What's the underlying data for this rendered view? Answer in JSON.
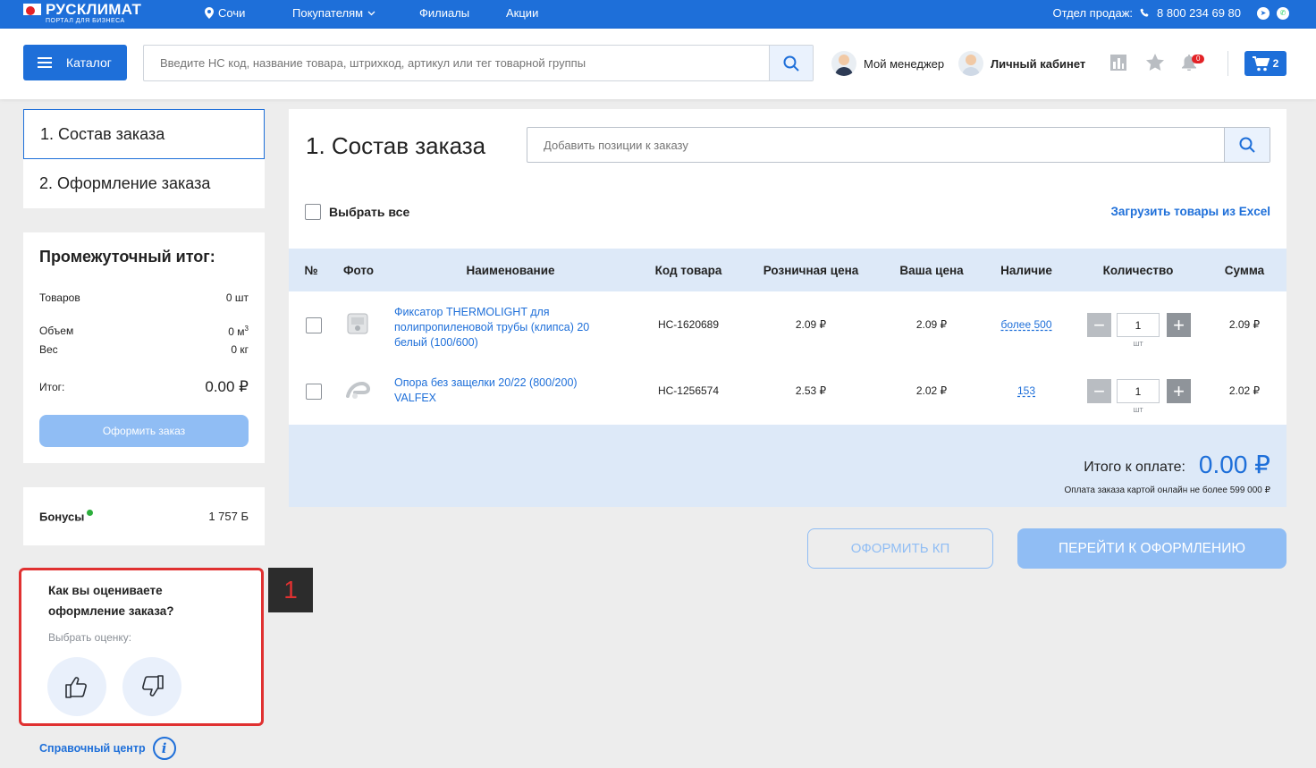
{
  "topbar": {
    "logo_main": "РУСКЛИМАТ",
    "logo_sub": "ПОРТАЛ ДЛЯ БИЗНЕСА",
    "city": "Сочи",
    "nav": [
      "Покупателям",
      "Филиалы",
      "Акции"
    ],
    "sales_label": "Отдел продаж:",
    "phone": "8 800 234 69 80",
    "colors": {
      "bar": "#1e6fd9"
    }
  },
  "header": {
    "catalog_label": "Каталог",
    "search_placeholder": "Введите НС код, название товара, штрихкод, артикул или тег товарной группы",
    "manager_label": "Мой менеджер",
    "cabinet_label": "Личный кабинет",
    "notifications_count": "0",
    "cart_count": "2",
    "icons": [
      "chart-icon",
      "star-icon",
      "bell-icon",
      "cart-icon"
    ]
  },
  "steps": [
    {
      "label": "1. Состав заказа",
      "active": true
    },
    {
      "label": "2. Оформление заказа",
      "active": false
    }
  ],
  "subtotal": {
    "title": "Промежуточный итог:",
    "goods_label": "Товаров",
    "goods_value": "0 шт",
    "volume_label": "Объем",
    "volume_value": "0 м",
    "volume_unit_sup": "3",
    "weight_label": "Вес",
    "weight_value": "0 кг",
    "total_label": "Итог:",
    "total_value": "0.00 ₽",
    "order_button": "Оформить заказ"
  },
  "bonus": {
    "label": "Бонусы",
    "value": "1 757 Б"
  },
  "rating": {
    "question": "Как вы оцениваете оформление заказа?",
    "prompt": "Выбрать оценку:",
    "marker": "1"
  },
  "help": {
    "label": "Справочный центр"
  },
  "main": {
    "title": "1. Состав заказа",
    "add_placeholder": "Добавить позиции к заказу",
    "select_all": "Выбрать все",
    "excel_link": "Загрузить товары из Excel",
    "columns": [
      "№",
      "Фото",
      "Наименование",
      "Код товара",
      "Розничная цена",
      "Ваша цена",
      "Наличие",
      "Количество",
      "Сумма"
    ],
    "rows": [
      {
        "name": "Фиксатор THERMOLIGHT для полипропиленовой трубы (клипса) 20 белый (100/600)",
        "code": "НС-1620689",
        "retail": "2.09 ₽",
        "price": "2.09 ₽",
        "stock": "более 500",
        "qty": "1",
        "unit": "шт",
        "sum": "2.09 ₽"
      },
      {
        "name": "Опора без защелки 20/22 (800/200) VALFEX",
        "code": "НС-1256574",
        "retail": "2.53 ₽",
        "price": "2.02 ₽",
        "stock": "153",
        "qty": "1",
        "unit": "шт",
        "sum": "2.02 ₽"
      }
    ],
    "total_label": "Итого к оплате:",
    "total_value": "0.00 ₽",
    "total_note": "Оплата заказа картой онлайн не более 599 000 ₽"
  },
  "actions": {
    "kp_button": "ОФОРМИТЬ КП",
    "checkout_button": "ПЕРЕЙТИ К ОФОРМЛЕНИЮ"
  }
}
